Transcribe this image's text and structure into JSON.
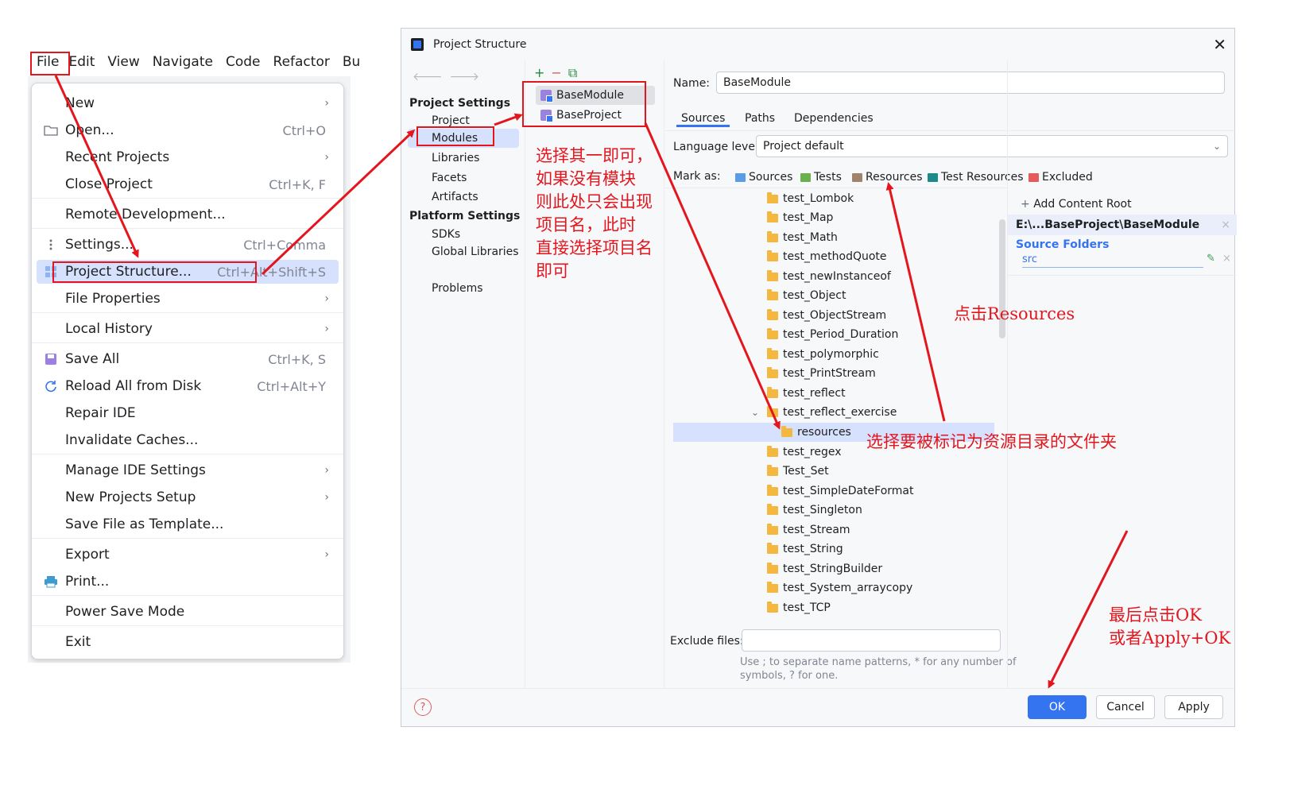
{
  "menu_bar": [
    "File",
    "Edit",
    "View",
    "Navigate",
    "Code",
    "Refactor",
    "Bu"
  ],
  "file_menu": [
    {
      "label": "New",
      "submenu": true
    },
    {
      "label": "Open...",
      "shortcut": "Ctrl+O",
      "icon": "folder-icon"
    },
    {
      "label": "Recent Projects",
      "submenu": true
    },
    {
      "label": "Close Project",
      "shortcut": "Ctrl+K, F"
    },
    {
      "label": "Remote Development..."
    },
    {
      "label": "Settings...",
      "shortcut": "Ctrl+Comma",
      "icon": "more-vertical-icon"
    },
    {
      "label": "Project Structure...",
      "shortcut": "Ctrl+Alt+Shift+S",
      "icon": "project-structure-icon",
      "selected": true
    },
    {
      "label": "File Properties",
      "submenu": true
    },
    {
      "label": "Local History",
      "submenu": true
    },
    {
      "label": "Save All",
      "shortcut": "Ctrl+K, S",
      "icon": "save-icon"
    },
    {
      "label": "Reload All from Disk",
      "shortcut": "Ctrl+Alt+Y",
      "icon": "reload-icon"
    },
    {
      "label": "Repair IDE"
    },
    {
      "label": "Invalidate Caches..."
    },
    {
      "label": "Manage IDE Settings",
      "submenu": true
    },
    {
      "label": "New Projects Setup",
      "submenu": true
    },
    {
      "label": "Save File as Template..."
    },
    {
      "label": "Export",
      "submenu": true
    },
    {
      "label": "Print...",
      "icon": "print-icon"
    },
    {
      "label": "Power Save Mode"
    },
    {
      "label": "Exit"
    }
  ],
  "dialog": {
    "title": "Project Structure",
    "project_settings_header": "Project Settings",
    "project_settings": [
      "Project",
      "Modules",
      "Libraries",
      "Facets",
      "Artifacts"
    ],
    "platform_settings_header": "Platform Settings",
    "platform_settings": [
      "SDKs",
      "Global Libraries"
    ],
    "problems": "Problems",
    "modules": [
      "BaseModule",
      "BaseProject"
    ],
    "name_label": "Name:",
    "name_value": "BaseModule",
    "tabs": [
      "Sources",
      "Paths",
      "Dependencies"
    ],
    "language_level_label": "Language level:",
    "language_level_value": "Project default",
    "mark_as_label": "Mark as:",
    "mark_as": [
      {
        "label": "Sources",
        "color": "#5c9ce6"
      },
      {
        "label": "Tests",
        "color": "#6ab04c"
      },
      {
        "label": "Resources",
        "color": "#a0826d"
      },
      {
        "label": "Test Resources",
        "color": "#1d8a8a"
      },
      {
        "label": "Excluded",
        "color": "#e55b5b"
      }
    ],
    "tree": [
      "test_Lombok",
      "test_Map",
      "test_Math",
      "test_methodQuote",
      "test_newInstanceof",
      "test_Object",
      "test_ObjectStream",
      "test_Period_Duration",
      "test_polymorphic",
      "test_PrintStream",
      "test_reflect",
      "test_reflect_exercise",
      "resources",
      "test_regex",
      "Test_Set",
      "test_SimpleDateFormat",
      "test_Singleton",
      "test_Stream",
      "test_String",
      "test_StringBuilder",
      "test_System_arraycopy",
      "test_TCP"
    ],
    "add_content_root": "Add Content Root",
    "content_root_path": "E:\\...BaseProject\\BaseModule",
    "source_folders_label": "Source Folders",
    "source_folder": "src",
    "exclude_files_label": "Exclude files:",
    "exclude_hint_1": "Use ; to separate name patterns, * for any number of",
    "exclude_hint_2": "symbols, ? for one.",
    "ok": "OK",
    "cancel": "Cancel",
    "apply": "Apply"
  },
  "annotations": {
    "pick_module": "选择其一即可，\n如果没有模块\n则此处只会出现\n项目名，此时\n直接选择项目名\n即可",
    "click_resources": "点击Resources",
    "select_folder": "选择要被标记为资源目录的文件夹",
    "click_ok": "最后点击OK\n或者Apply+OK"
  },
  "colors": {
    "annotation_red": "#e3161e",
    "accent_blue": "#3574f0",
    "selection": "#d5e1fd"
  }
}
